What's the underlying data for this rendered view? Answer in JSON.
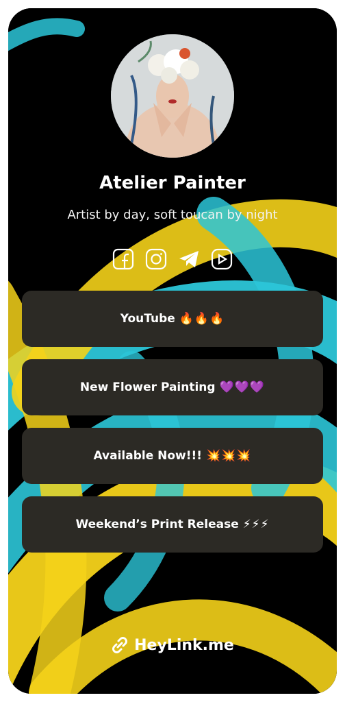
{
  "profile": {
    "name": "Atelier Painter",
    "bio": "Artist by day, soft toucan by night"
  },
  "socials": [
    {
      "icon": "facebook-icon"
    },
    {
      "icon": "instagram-icon"
    },
    {
      "icon": "telegram-icon"
    },
    {
      "icon": "youtube-icon"
    }
  ],
  "links": [
    {
      "label": "YouTube",
      "emoji": "🔥🔥🔥"
    },
    {
      "label": "New Flower Painting",
      "emoji": "💜💜💜"
    },
    {
      "label": "Available Now!!!",
      "emoji": "💥💥💥"
    },
    {
      "label": "Weekend’s Print Release",
      "emoji": "⚡⚡⚡"
    }
  ],
  "brand": {
    "label": "HeyLink.me"
  },
  "colors": {
    "button_bg": "#2c2a25",
    "swirl_yellow": "#f4d21a",
    "swirl_cyan": "#2cc6d8"
  }
}
